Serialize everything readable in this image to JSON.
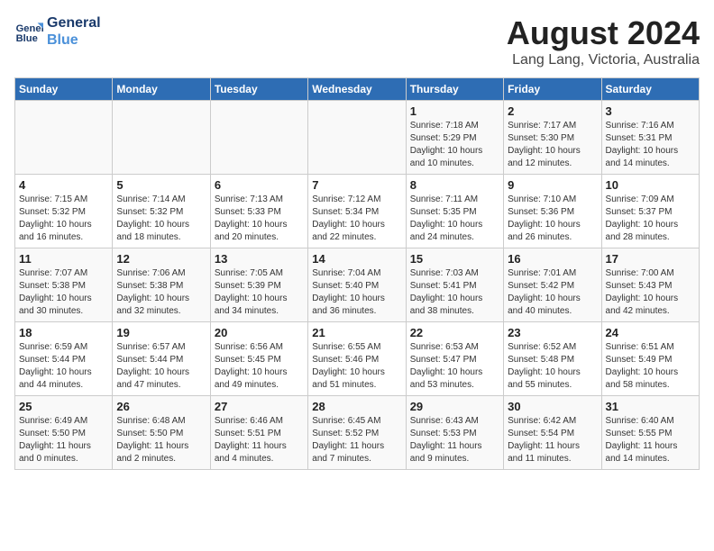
{
  "logo": {
    "line1": "General",
    "line2": "Blue"
  },
  "title": "August 2024",
  "location": "Lang Lang, Victoria, Australia",
  "header_days": [
    "Sunday",
    "Monday",
    "Tuesday",
    "Wednesday",
    "Thursday",
    "Friday",
    "Saturday"
  ],
  "weeks": [
    [
      {
        "day": "",
        "info": ""
      },
      {
        "day": "",
        "info": ""
      },
      {
        "day": "",
        "info": ""
      },
      {
        "day": "",
        "info": ""
      },
      {
        "day": "1",
        "info": "Sunrise: 7:18 AM\nSunset: 5:29 PM\nDaylight: 10 hours\nand 10 minutes."
      },
      {
        "day": "2",
        "info": "Sunrise: 7:17 AM\nSunset: 5:30 PM\nDaylight: 10 hours\nand 12 minutes."
      },
      {
        "day": "3",
        "info": "Sunrise: 7:16 AM\nSunset: 5:31 PM\nDaylight: 10 hours\nand 14 minutes."
      }
    ],
    [
      {
        "day": "4",
        "info": "Sunrise: 7:15 AM\nSunset: 5:32 PM\nDaylight: 10 hours\nand 16 minutes."
      },
      {
        "day": "5",
        "info": "Sunrise: 7:14 AM\nSunset: 5:32 PM\nDaylight: 10 hours\nand 18 minutes."
      },
      {
        "day": "6",
        "info": "Sunrise: 7:13 AM\nSunset: 5:33 PM\nDaylight: 10 hours\nand 20 minutes."
      },
      {
        "day": "7",
        "info": "Sunrise: 7:12 AM\nSunset: 5:34 PM\nDaylight: 10 hours\nand 22 minutes."
      },
      {
        "day": "8",
        "info": "Sunrise: 7:11 AM\nSunset: 5:35 PM\nDaylight: 10 hours\nand 24 minutes."
      },
      {
        "day": "9",
        "info": "Sunrise: 7:10 AM\nSunset: 5:36 PM\nDaylight: 10 hours\nand 26 minutes."
      },
      {
        "day": "10",
        "info": "Sunrise: 7:09 AM\nSunset: 5:37 PM\nDaylight: 10 hours\nand 28 minutes."
      }
    ],
    [
      {
        "day": "11",
        "info": "Sunrise: 7:07 AM\nSunset: 5:38 PM\nDaylight: 10 hours\nand 30 minutes."
      },
      {
        "day": "12",
        "info": "Sunrise: 7:06 AM\nSunset: 5:38 PM\nDaylight: 10 hours\nand 32 minutes."
      },
      {
        "day": "13",
        "info": "Sunrise: 7:05 AM\nSunset: 5:39 PM\nDaylight: 10 hours\nand 34 minutes."
      },
      {
        "day": "14",
        "info": "Sunrise: 7:04 AM\nSunset: 5:40 PM\nDaylight: 10 hours\nand 36 minutes."
      },
      {
        "day": "15",
        "info": "Sunrise: 7:03 AM\nSunset: 5:41 PM\nDaylight: 10 hours\nand 38 minutes."
      },
      {
        "day": "16",
        "info": "Sunrise: 7:01 AM\nSunset: 5:42 PM\nDaylight: 10 hours\nand 40 minutes."
      },
      {
        "day": "17",
        "info": "Sunrise: 7:00 AM\nSunset: 5:43 PM\nDaylight: 10 hours\nand 42 minutes."
      }
    ],
    [
      {
        "day": "18",
        "info": "Sunrise: 6:59 AM\nSunset: 5:44 PM\nDaylight: 10 hours\nand 44 minutes."
      },
      {
        "day": "19",
        "info": "Sunrise: 6:57 AM\nSunset: 5:44 PM\nDaylight: 10 hours\nand 47 minutes."
      },
      {
        "day": "20",
        "info": "Sunrise: 6:56 AM\nSunset: 5:45 PM\nDaylight: 10 hours\nand 49 minutes."
      },
      {
        "day": "21",
        "info": "Sunrise: 6:55 AM\nSunset: 5:46 PM\nDaylight: 10 hours\nand 51 minutes."
      },
      {
        "day": "22",
        "info": "Sunrise: 6:53 AM\nSunset: 5:47 PM\nDaylight: 10 hours\nand 53 minutes."
      },
      {
        "day": "23",
        "info": "Sunrise: 6:52 AM\nSunset: 5:48 PM\nDaylight: 10 hours\nand 55 minutes."
      },
      {
        "day": "24",
        "info": "Sunrise: 6:51 AM\nSunset: 5:49 PM\nDaylight: 10 hours\nand 58 minutes."
      }
    ],
    [
      {
        "day": "25",
        "info": "Sunrise: 6:49 AM\nSunset: 5:50 PM\nDaylight: 11 hours\nand 0 minutes."
      },
      {
        "day": "26",
        "info": "Sunrise: 6:48 AM\nSunset: 5:50 PM\nDaylight: 11 hours\nand 2 minutes."
      },
      {
        "day": "27",
        "info": "Sunrise: 6:46 AM\nSunset: 5:51 PM\nDaylight: 11 hours\nand 4 minutes."
      },
      {
        "day": "28",
        "info": "Sunrise: 6:45 AM\nSunset: 5:52 PM\nDaylight: 11 hours\nand 7 minutes."
      },
      {
        "day": "29",
        "info": "Sunrise: 6:43 AM\nSunset: 5:53 PM\nDaylight: 11 hours\nand 9 minutes."
      },
      {
        "day": "30",
        "info": "Sunrise: 6:42 AM\nSunset: 5:54 PM\nDaylight: 11 hours\nand 11 minutes."
      },
      {
        "day": "31",
        "info": "Sunrise: 6:40 AM\nSunset: 5:55 PM\nDaylight: 11 hours\nand 14 minutes."
      }
    ]
  ]
}
